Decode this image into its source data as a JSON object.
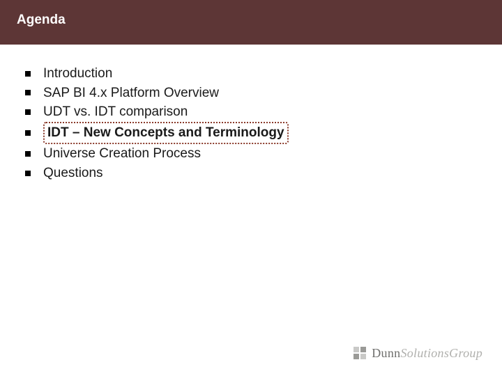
{
  "header": {
    "title": "Agenda"
  },
  "agenda": {
    "items": [
      {
        "label": "Introduction",
        "bold": false,
        "highlight": false
      },
      {
        "label": "SAP BI 4.x Platform Overview",
        "bold": false,
        "highlight": false
      },
      {
        "label": "UDT vs. IDT comparison",
        "bold": false,
        "highlight": false
      },
      {
        "label": "IDT – New Concepts and Terminology",
        "bold": true,
        "highlight": true
      },
      {
        "label": "Universe Creation Process",
        "bold": false,
        "highlight": false
      },
      {
        "label": "Questions",
        "bold": false,
        "highlight": false
      }
    ]
  },
  "footer": {
    "logo_part1": "Dunn",
    "logo_part2": "SolutionsGroup"
  }
}
